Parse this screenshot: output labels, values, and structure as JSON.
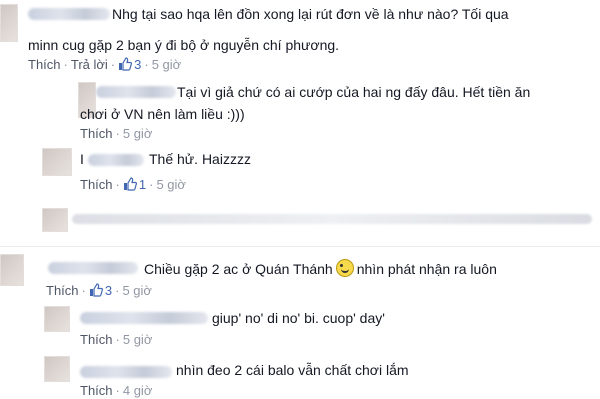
{
  "comments": [
    {
      "text_line1": "Nhg tại sao hqa lên đồn xong lại rút đơn về là như nào? Tối qua",
      "text_line2": "minn cug gặp 2 bạn ý đi bộ ở nguyễn chí phương.",
      "like_label": "Thích",
      "reply_label": "Trả lời",
      "like_count": "3",
      "time": "5 giờ",
      "replies": [
        {
          "text_line1": "Tại vì giả chứ có ai cướp của hai ng đấy đâu. Hết tiền ăn",
          "text_line2": "chơi ở VN nên làm liều :)))",
          "like_label": "Thích",
          "time": "5 giờ"
        },
        {
          "prefix": "I",
          "text": "Thế hử. Haizzzz",
          "like_label": "Thích",
          "like_count": "1",
          "time": "5 giờ"
        }
      ]
    },
    {
      "text": "Chiều gặp 2 ac ở Quán Thánh",
      "text_after_emoji": "nhìn phát nhận ra luôn",
      "like_label": "Thích",
      "like_count": "3",
      "time": "5 giờ",
      "replies": [
        {
          "text": "giup' no' di no' bi. cuop' day'",
          "like_label": "Thích",
          "time": "5 giờ"
        },
        {
          "text": "nhìn đeo 2 cái balo vẫn chất chơi lắm",
          "like_label": "Thích",
          "time": "4 giờ"
        }
      ]
    }
  ],
  "icons": {
    "like": "thumbs-up-icon",
    "emoji": "grin-emoji-icon"
  },
  "colors": {
    "link": "#4e5665",
    "meta": "#9197a3",
    "like_blue": "#4267b2"
  }
}
